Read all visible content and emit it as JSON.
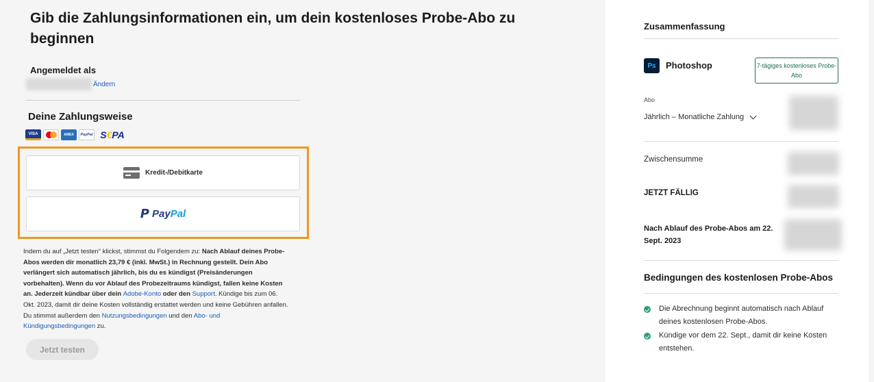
{
  "main": {
    "title": "Gib die Zahlungsinformationen ein, um dein kostenloses Probe-Abo zu beginnen",
    "signed_in_label": "Angemeldet als",
    "change_link": "Ändern",
    "payment_title": "Deine Zahlungsweise",
    "payment_logos": [
      "visa-logo",
      "mastercard-logo",
      "amex-logo",
      "paypal-logo",
      "sepa-logo"
    ],
    "logo_text": {
      "visa": "VISA",
      "amex": "AMEX",
      "paypal": "PayPal",
      "sepa_s": "S",
      "sepa_e": "€",
      "sepa_pa": "PA"
    },
    "card_button_label": "Kredit-/Debitkarte",
    "paypal_p": "P",
    "paypal_pay": "Pay",
    "paypal_pal": "Pal",
    "legal": {
      "t1": "Indem du auf „Jetzt testen“ klickst, stimmst du Folgendem zu: ",
      "b1": "Nach Ablauf deines Probe-Abos werden dir monatlich 23,79 € (inkl. MwSt.) in Rechnung gestellt. Dein Abo verlängert sich automatisch jährlich, bis du es kündigst (Preisänderungen vorbehalten). Wenn du vor Ablauf des Probezeitraums kündigst, fallen keine Kosten an. Jederzeit kündbar über dein ",
      "l1": "Adobe-Konto",
      "b2": " oder den ",
      "l2": "Support",
      "t2": ". Kündige bis zum 06. Okt. 2023, damit dir deine Kosten vollständig erstattet werden und keine Gebühren anfallen. Du stimmst außerdem den ",
      "l3": "Nutzungsbedingungen",
      "t3": " und den ",
      "l4": "Abo- und Kündigungsbedingungen",
      "t4": " zu."
    },
    "try_button": "Jetzt testen"
  },
  "summary": {
    "title": "Zusammenfassung",
    "product_icon": "Ps",
    "product_name": "Photoshop",
    "trial_badge": "7-tägiges kostenloses Probe-Abo",
    "plan_label": "Abo",
    "plan_value": "Jährlich – Monatliche Zahlung",
    "subtotal_label": "Zwischensumme",
    "due_now_label": "JETZT FÄLLIG",
    "after_trial_label": "Nach Ablauf des Probe-Abos am 22. Sept. 2023",
    "conditions_title": "Bedingungen des kostenlosen Probe-Abos",
    "conditions": [
      "Die Abrechnung beginnt automatisch nach Ablauf deines kostenlosen Probe-Abos.",
      "Kündige vor dem 22. Sept., damit dir keine Kosten entstehen."
    ]
  },
  "colors": {
    "highlight_border": "#f0961f",
    "link": "#1a5bb5",
    "badge_green": "#1c6e55",
    "check_green": "#2d9d78"
  }
}
